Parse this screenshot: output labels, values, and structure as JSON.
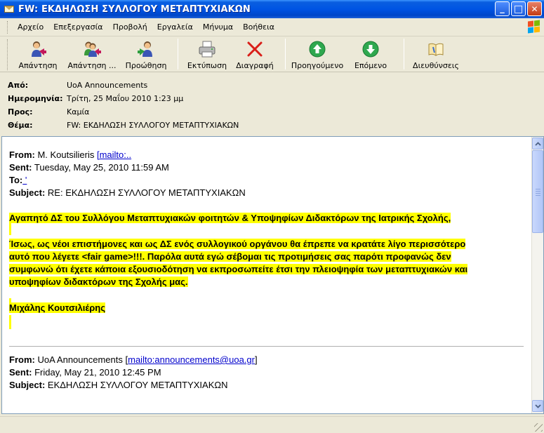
{
  "window": {
    "title": "FW: ΕΚΔΗΛΩΣΗ ΣΥΛΛΟΓΟΥ ΜΕΤΑΠΤΥΧΙΑΚΩΝ",
    "minimize": "_",
    "maximize": "□",
    "close": "✕"
  },
  "menu": {
    "items": [
      {
        "label": "Αρχείο"
      },
      {
        "label": "Επεξεργασία"
      },
      {
        "label": "Προβολή"
      },
      {
        "label": "Εργαλεία"
      },
      {
        "label": "Μήνυμα"
      },
      {
        "label": "Βοήθεια"
      }
    ]
  },
  "toolbar": {
    "reply": "Απάντηση",
    "reply_all": "Απάντηση ...",
    "forward": "Προώθηση",
    "print": "Εκτύπωση",
    "delete": "Διαγραφή",
    "previous": "Προηγούμενο",
    "next": "Επόμενο",
    "addresses": "Διευθύνσεις"
  },
  "headers": {
    "from_label": "Από:",
    "from_value": "UoA Announcements",
    "date_label": "Ημερομηνία:",
    "date_value": "Τρίτη, 25 Μαΐου 2010 1:23 μμ",
    "to_label": "Προς:",
    "to_value": "Καμία",
    "subject_label": "Θέμα:",
    "subject_value": "FW: ΕΚΔΗΛΩΣΗ ΣΥΛΛΟΓΟΥ ΜΕΤΑΠΤΥΧΙΑΚΩΝ"
  },
  "message": {
    "q1": {
      "from_label": "From:",
      "from_name": " M. Koutsilieris ",
      "from_link": "[mailto:..",
      "sent_label": "Sent:",
      "sent_value": " Tuesday, May 25, 2010 11:59 AM",
      "to_label": "To:",
      "to_value": " '",
      "subject_label": "Subject:",
      "subject_value": " RE: ΕΚΔΗΛΩΣΗ ΣΥΛΛΟΓΟΥ ΜΕΤΑΠΤΥΧΙΑΚΩΝ"
    },
    "p1": "Αγαπητό ΔΣ του Συλλόγου Μεταπτυχιακών φοιτητών & Υποψηφίων Διδακτόρων της Ιατρικής Σχολής,",
    "p2_l1": "Ίσως, ως νέοι επιστήμονες και ως ΔΣ ενός συλλογικού οργάνου θα έπρεπε να κρατάτε λίγο περισσότερο",
    "p2_l2": "αυτό που λέγετε <fair game>!!!. Παρόλα αυτά εγώ σέβομαι τις προτιμήσεις σας παρότι προφανώς δεν",
    "p2_l3": "συμφωνώ ότι έχετε κάποια εξουσιοδότηση να εκπροσωπείτε έτσι την πλειοψηφία των μεταπτυχιακών και",
    "p2_l4": "υποψηφίων διδακτόρων της Σχολής μας.",
    "signature": "Μιχάλης Κουτσιλιέρης",
    "q2": {
      "from_label": "From:",
      "from_name": " UoA Announcements ",
      "from_link": "mailto:announcements@uoa.gr",
      "bracket_open": "[",
      "bracket_close": "]",
      "sent_label": "Sent:",
      "sent_value": " Friday, May 21, 2010 12:45 PM",
      "subject_label": "Subject:",
      "subject_value": " ΕΚΔΗΛΩΣΗ ΣΥΛΛΟΓΟΥ ΜΕΤΑΠΤΥΧΙΑΚΩΝ"
    }
  },
  "colors": {
    "titlebar": "#0054e3",
    "highlight": "#ffff00",
    "link": "#0000cc"
  }
}
